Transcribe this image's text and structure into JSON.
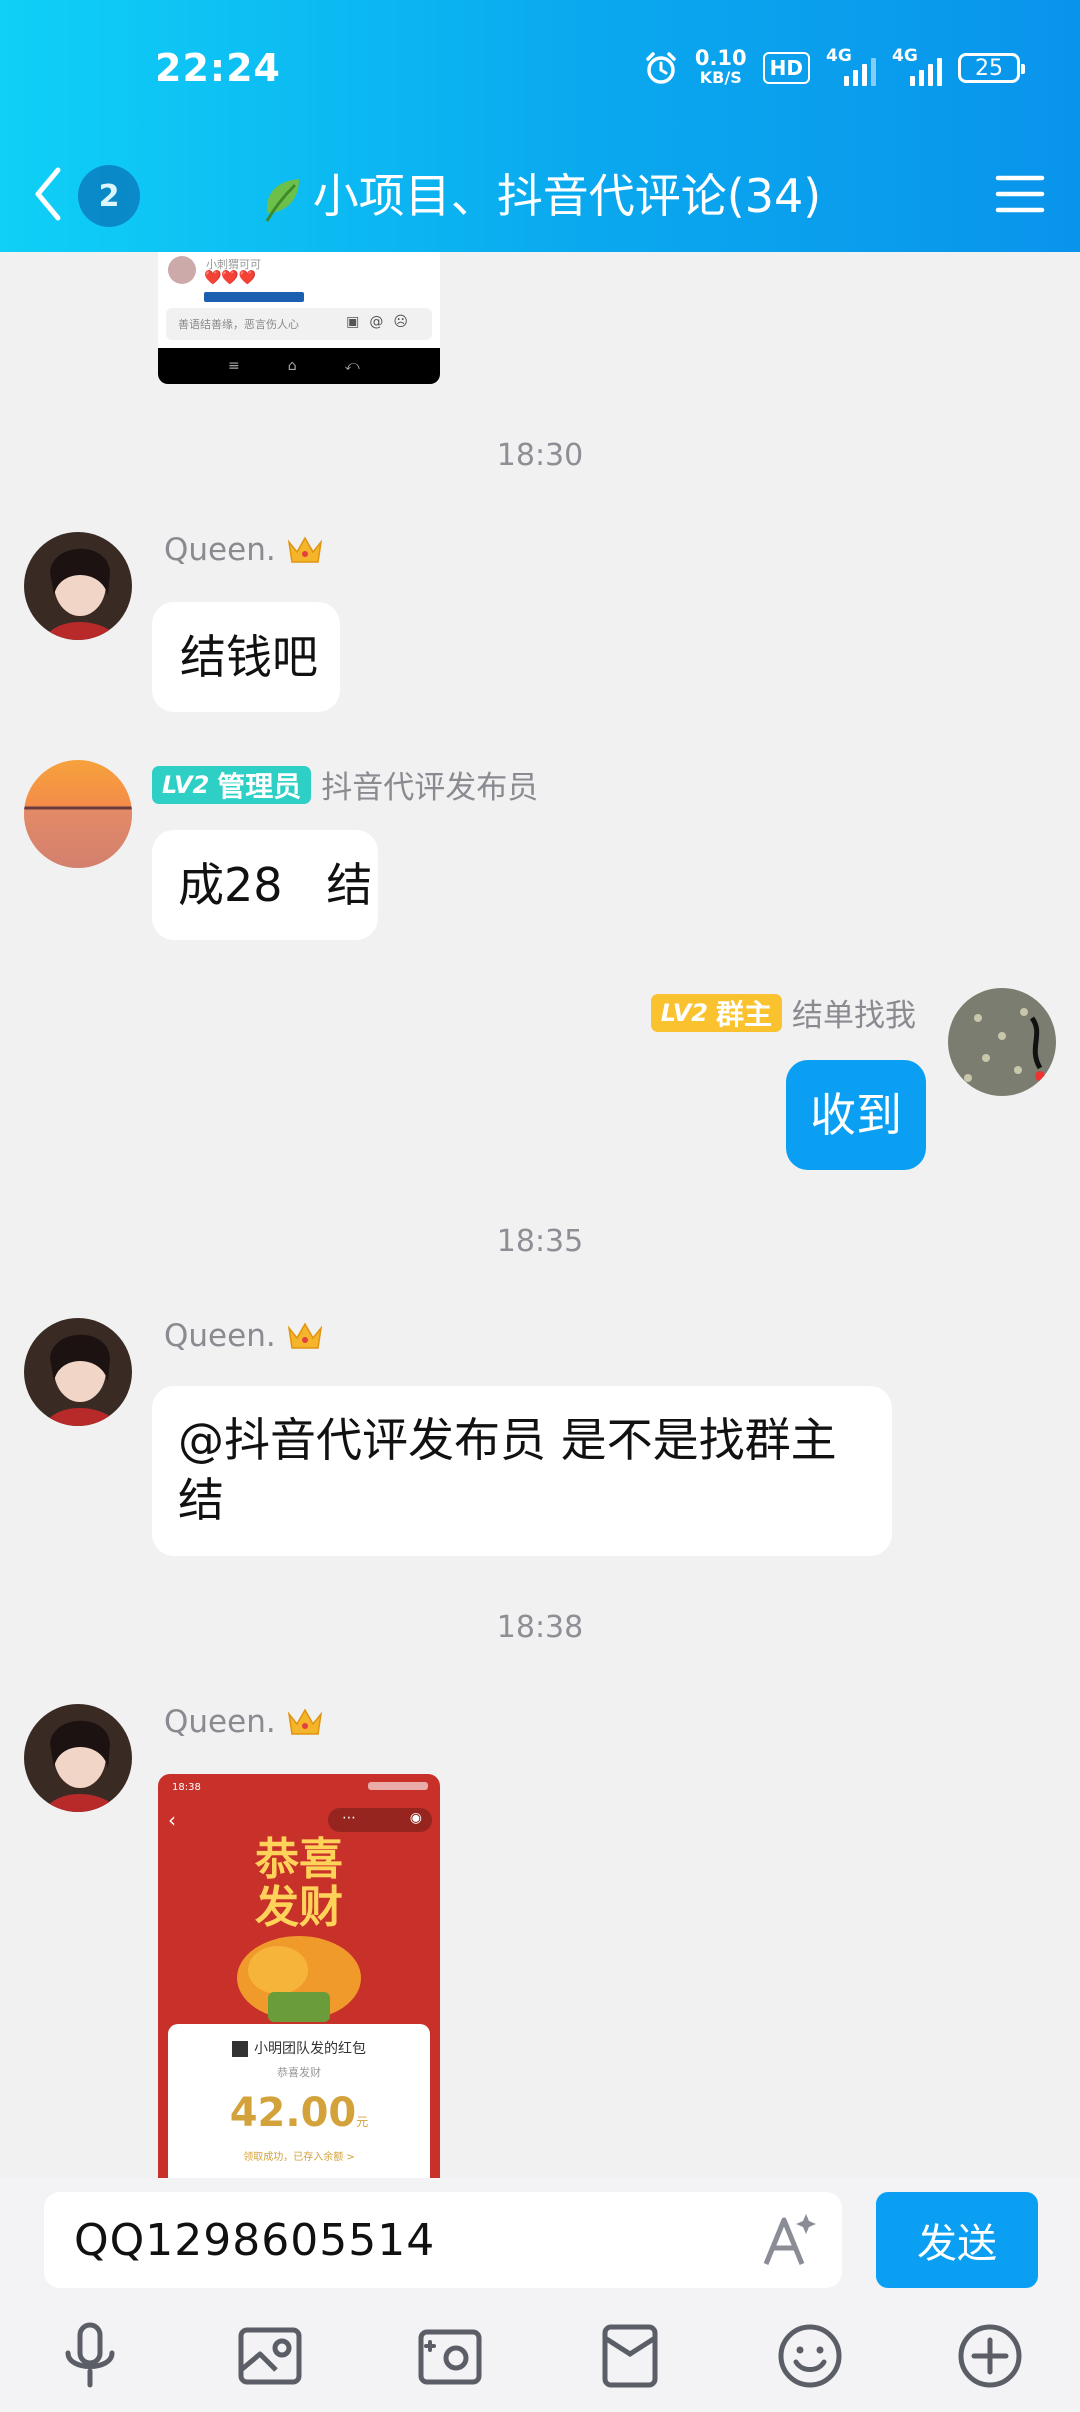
{
  "status_bar": {
    "time": "22:24",
    "net_speed_value": "0.10",
    "net_speed_unit": "KB/S",
    "hd_label": "HD",
    "signal_1_label": "4G",
    "signal_2_label": "4G",
    "battery": "25"
  },
  "header": {
    "back_badge": "2",
    "title": "小项目、抖音代评论(34)"
  },
  "messages": {
    "ts_1": "18:30",
    "m1": {
      "sender": "Queen.",
      "text": "结钱吧"
    },
    "m2": {
      "level": "LV2",
      "role": "管理员",
      "sender": "抖音代评发布员",
      "text": "成28   结"
    },
    "m3": {
      "level": "LV2",
      "role": "群主",
      "sender": "结单找我",
      "text": "收到"
    },
    "ts_2": "18:35",
    "m4": {
      "sender": "Queen.",
      "text": "@抖音代评发布员 是不是找群主结"
    },
    "ts_3": "18:38",
    "m5": {
      "sender": "Queen."
    }
  },
  "thumb_top": {
    "commenter": "小刺猬可可",
    "hearts": "❤️❤️❤️",
    "input_placeholder": "善语结善缘，恶言伤人心"
  },
  "thumb_redpacket": {
    "time": "18:38",
    "headline_1": "恭喜",
    "headline_2": "发财",
    "packet_from": "小明团队发的红包",
    "greeting": "恭喜发财",
    "amount": "42.00",
    "unit": "元",
    "received_note": "领取成功，已存入余额 >"
  },
  "input": {
    "value": "QQ1298605514",
    "send_label": "发送"
  },
  "colors": {
    "accent": "#0a9ff2",
    "admin_tag": "#2ecfc4",
    "owner_tag": "#f9c22e"
  }
}
